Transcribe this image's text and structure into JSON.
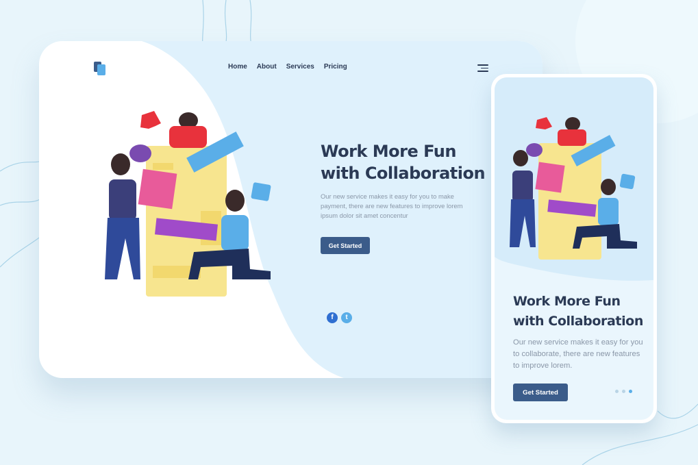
{
  "desktop": {
    "nav": [
      "Home",
      "About",
      "Services",
      "Pricing"
    ],
    "hero": {
      "title_line1": "Work More Fun",
      "title_prefix": "with ",
      "title_highlight": "Collaboration",
      "description": "Our new service makes it easy for you to make payment, there are new features to improve lorem ipsum dolor sit amet concentur",
      "cta_label": "Get Started"
    },
    "social": {
      "facebook": "f",
      "twitter": "t"
    }
  },
  "mobile": {
    "title_line1": "Work More Fun",
    "title_prefix": "with ",
    "title_highlight": "Collaboration",
    "description": "Our new service makes it easy for you to collaborate, there are new features to improve lorem.",
    "cta_label": "Get Started",
    "pagination": {
      "count": 3,
      "active": 3
    }
  },
  "colors": {
    "background": "#e8f5fb",
    "panel": "#dff1fc",
    "accent": "#3b5c8a",
    "heading": "#2b3a55",
    "highlight": "#f6df8a"
  },
  "icons": [
    "logo-icon",
    "hamburger-menu-icon",
    "facebook-icon",
    "twitter-icon"
  ]
}
